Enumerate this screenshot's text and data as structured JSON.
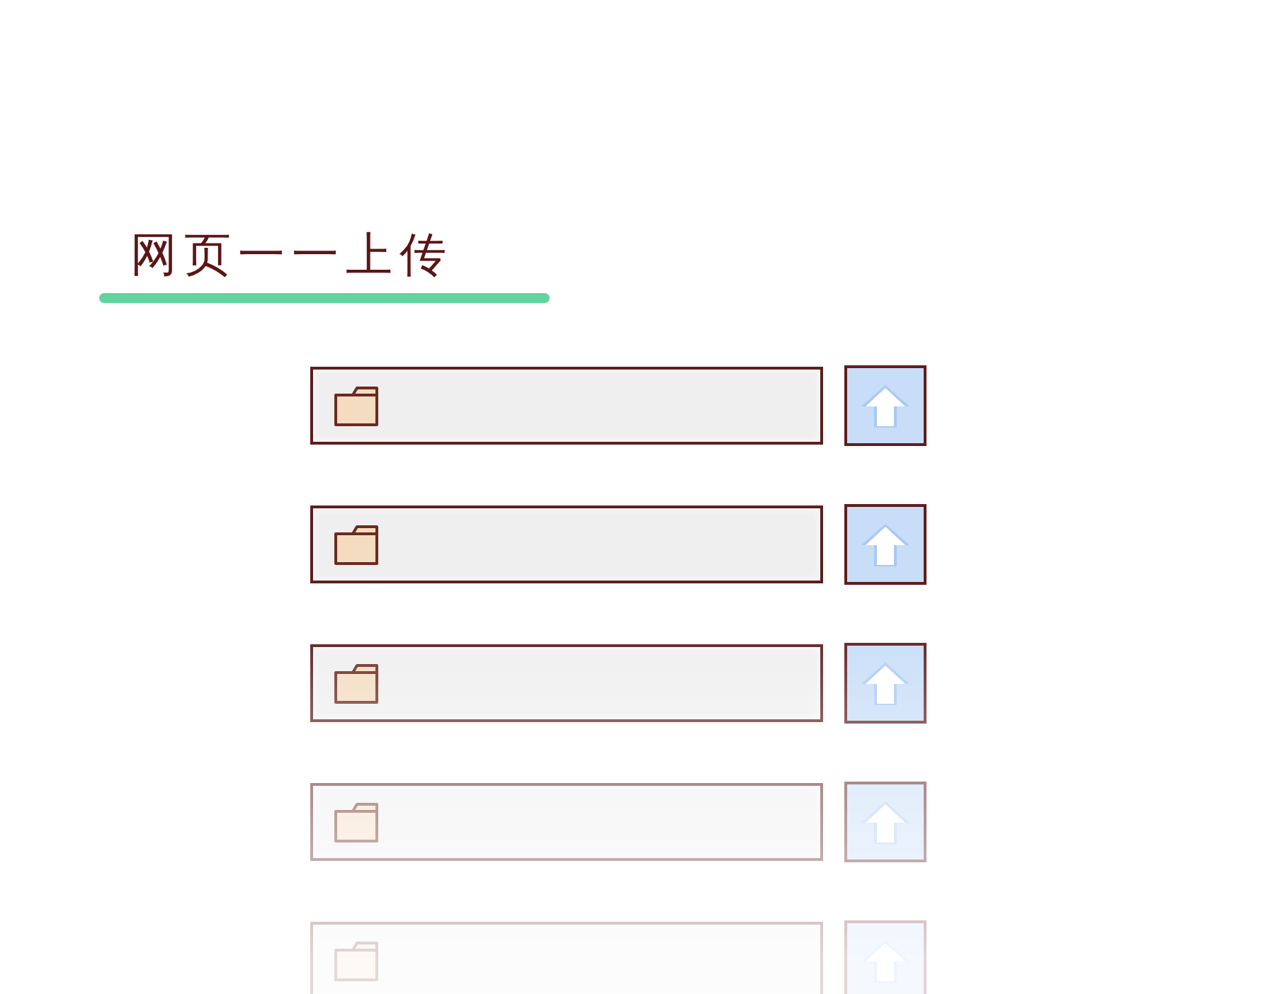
{
  "title": "网页一一上传",
  "upload_rows": [
    {
      "kind": "file-upload"
    },
    {
      "kind": "file-upload"
    },
    {
      "kind": "file-upload"
    },
    {
      "kind": "file-upload"
    },
    {
      "kind": "file-upload"
    }
  ]
}
